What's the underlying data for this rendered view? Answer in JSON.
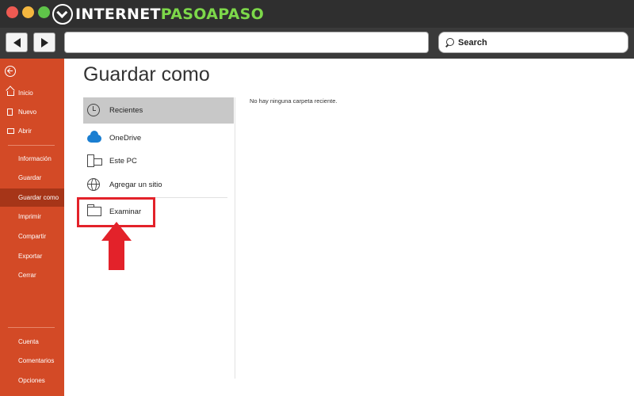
{
  "branding": {
    "logo_part1": "INTERNET",
    "logo_part2": "PASOAPASO"
  },
  "browser": {
    "search_placeholder": "Search"
  },
  "sidebar": {
    "items_top": [
      {
        "label": "Inicio",
        "icon": "home-icon"
      },
      {
        "label": "Nuevo",
        "icon": "new-file-icon"
      },
      {
        "label": "Abrir",
        "icon": "folder-open-icon"
      }
    ],
    "items_mid": [
      {
        "label": "Información"
      },
      {
        "label": "Guardar"
      },
      {
        "label": "Guardar como",
        "active": true
      },
      {
        "label": "Imprimir"
      },
      {
        "label": "Compartir"
      },
      {
        "label": "Exportar"
      },
      {
        "label": "Cerrar"
      }
    ],
    "items_bottom": [
      {
        "label": "Cuenta"
      },
      {
        "label": "Comentarios"
      },
      {
        "label": "Opciones"
      }
    ]
  },
  "main": {
    "title": "Guardar como",
    "locations": [
      {
        "label": "Recientes",
        "icon": "clock-icon",
        "selected": true
      },
      {
        "label": "OneDrive",
        "icon": "cloud-icon"
      },
      {
        "label": "Este PC",
        "icon": "computer-icon"
      },
      {
        "label": "Agregar un sitio",
        "icon": "globe-icon"
      },
      {
        "label": "Examinar",
        "icon": "folder-icon"
      }
    ],
    "empty_message": "No hay ninguna carpeta reciente."
  },
  "colors": {
    "sidebar": "#d34a26",
    "sidebar_active": "#a63518",
    "annotation_red": "#e3222a",
    "onedrive_blue": "#1a7ed1"
  }
}
